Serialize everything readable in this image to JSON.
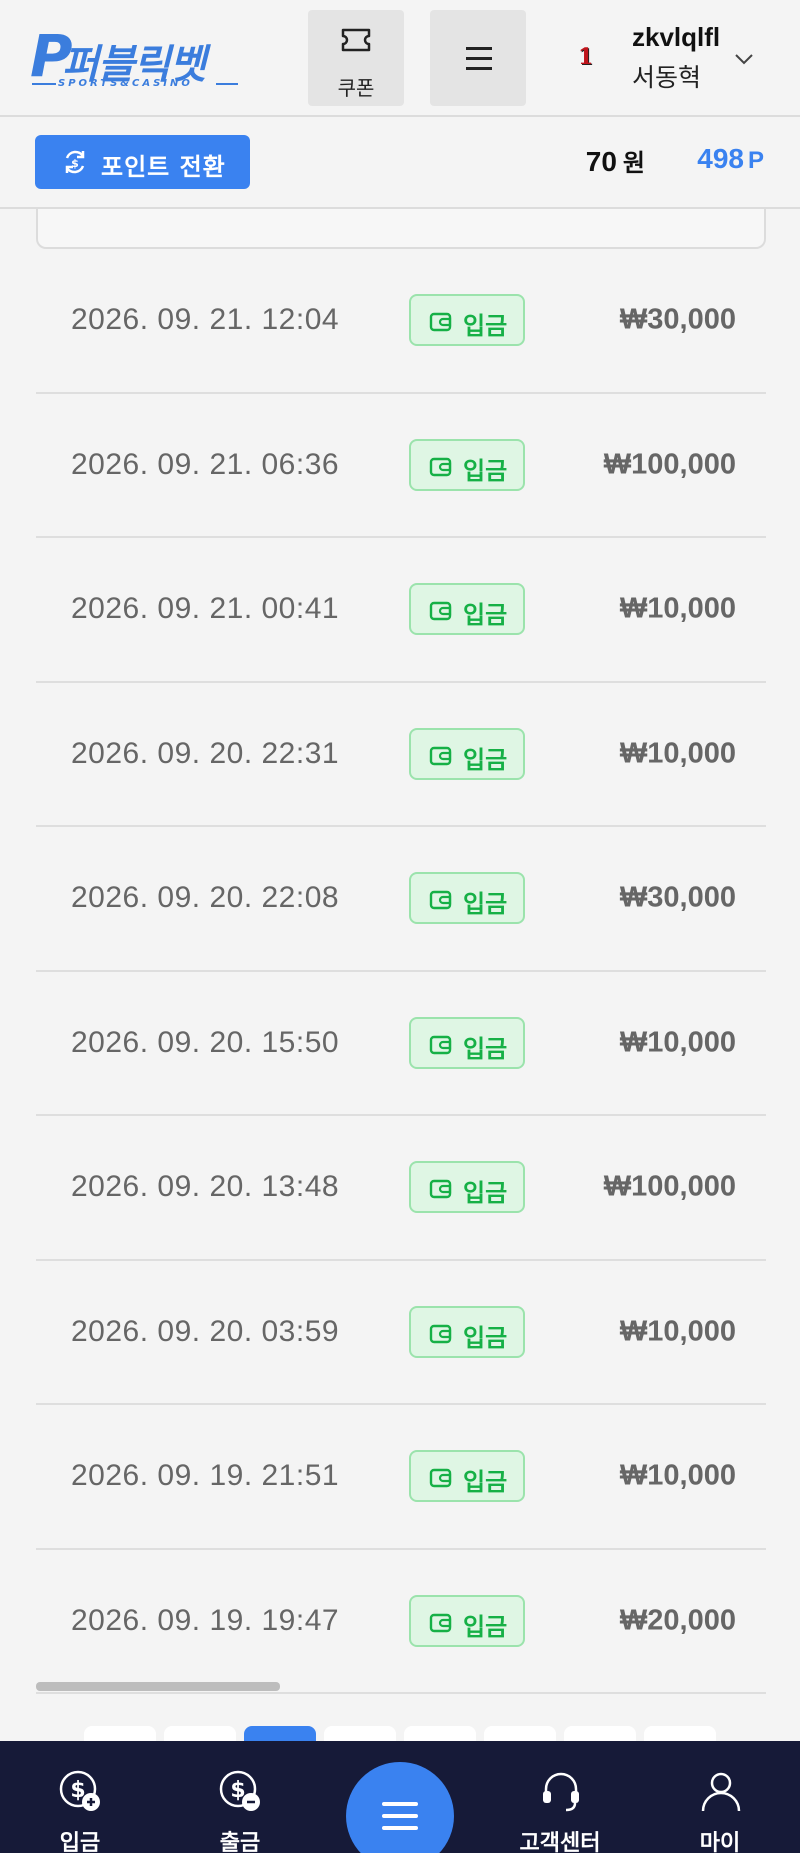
{
  "header": {
    "logo_text": "퍼블릭벳",
    "logo_sub": "SPORTS&CASINO",
    "coupon_label": "쿠폰",
    "rank_badge": "1",
    "username": "zkvlqlfl",
    "realname": "서동혁"
  },
  "pointbar": {
    "convert_label": "포인트 전환",
    "money_value": "70",
    "money_unit": "원",
    "points_value": "498",
    "points_unit": "P"
  },
  "transactions": [
    {
      "date": "2026. 09. 21. 12:04",
      "type": "입금",
      "amount": "₩30,000"
    },
    {
      "date": "2026. 09. 21. 06:36",
      "type": "입금",
      "amount": "₩100,000"
    },
    {
      "date": "2026. 09. 21. 00:41",
      "type": "입금",
      "amount": "₩10,000"
    },
    {
      "date": "2026. 09. 20. 22:31",
      "type": "입금",
      "amount": "₩10,000"
    },
    {
      "date": "2026. 09. 20. 22:08",
      "type": "입금",
      "amount": "₩30,000"
    },
    {
      "date": "2026. 09. 20. 15:50",
      "type": "입금",
      "amount": "₩10,000"
    },
    {
      "date": "2026. 09. 20. 13:48",
      "type": "입금",
      "amount": "₩100,000"
    },
    {
      "date": "2026. 09. 20. 03:59",
      "type": "입금",
      "amount": "₩10,000"
    },
    {
      "date": "2026. 09. 19. 21:51",
      "type": "입금",
      "amount": "₩10,000"
    },
    {
      "date": "2026. 09. 19. 19:47",
      "type": "입금",
      "amount": "₩20,000"
    }
  ],
  "bottom_nav": {
    "deposit": "입금",
    "withdraw": "출금",
    "support": "고객센터",
    "my": "마이"
  },
  "colors": {
    "accent": "#3a82f0",
    "deposit_badge_text": "#16b046",
    "deposit_badge_bg": "#dff6e4",
    "nav_bg": "#161a38"
  }
}
